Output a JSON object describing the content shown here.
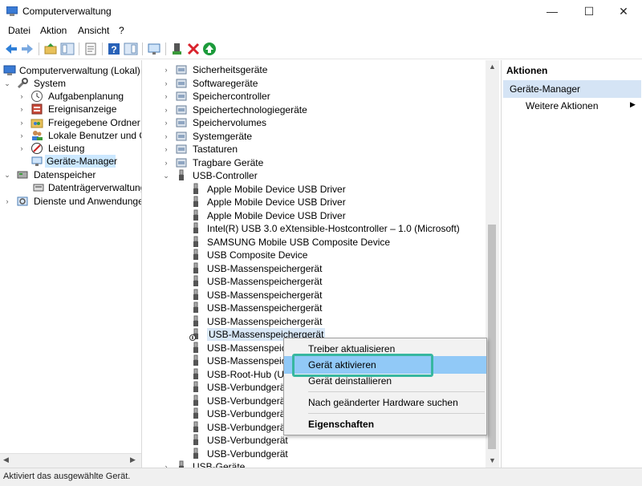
{
  "window": {
    "title": "Computerverwaltung",
    "minimize": "—",
    "maximize": "☐",
    "close": "✕"
  },
  "menu": [
    "Datei",
    "Aktion",
    "Ansicht",
    "?"
  ],
  "left_tree": {
    "root": "Computerverwaltung (Lokal)",
    "system": "System",
    "children": [
      "Aufgabenplanung",
      "Ereignisanzeige",
      "Freigegebene Ordner",
      "Lokale Benutzer und Gru",
      "Leistung",
      "Geräte-Manager"
    ],
    "storage": "Datenspeicher",
    "storage_children": [
      "Datenträgerverwaltung"
    ],
    "services": "Dienste und Anwendungen"
  },
  "device_tree": {
    "categories_top": [
      "Sicherheitsgeräte",
      "Softwaregeräte",
      "Speichercontroller",
      "Speichertechnologiegeräte",
      "Speichervolumes",
      "Systemgeräte",
      "Tastaturen",
      "Tragbare Geräte"
    ],
    "usb_controller": "USB-Controller",
    "usb_devices": [
      "Apple Mobile Device USB Driver",
      "Apple Mobile Device USB Driver",
      "Apple Mobile Device USB Driver",
      "Intel(R) USB 3.0 eXtensible-Hostcontroller – 1.0 (Microsoft)",
      "SAMSUNG Mobile USB Composite Device",
      "USB Composite Device",
      "USB-Massenspeichergerät",
      "USB-Massenspeichergerät",
      "USB-Massenspeichergerät",
      "USB-Massenspeichergerät",
      "USB-Massenspeichergerät",
      "USB-Massenspeichergerät",
      "USB-Massenspeiche",
      "USB-Massenspeiche",
      "USB-Root-Hub (USB",
      "USB-Verbundgerät",
      "USB-Verbundgerät",
      "USB-Verbundgerät",
      "USB-Verbundgerät",
      "USB-Verbundgerät",
      "USB-Verbundgerät"
    ],
    "usb_geraete": "USB-Geräte"
  },
  "context_menu": {
    "items": [
      "Treiber aktualisieren",
      "Gerät aktivieren",
      "Gerät deinstallieren",
      "Nach geänderter Hardware suchen",
      "Eigenschaften"
    ]
  },
  "actions": {
    "header": "Aktionen",
    "section": "Geräte-Manager",
    "more": "Weitere Aktionen"
  },
  "status": "Aktiviert das ausgewählte Gerät.",
  "colors": {
    "accent_highlight": "#37b7a0",
    "menu_hover": "#91c9f7",
    "selection": "#cce8ff"
  }
}
